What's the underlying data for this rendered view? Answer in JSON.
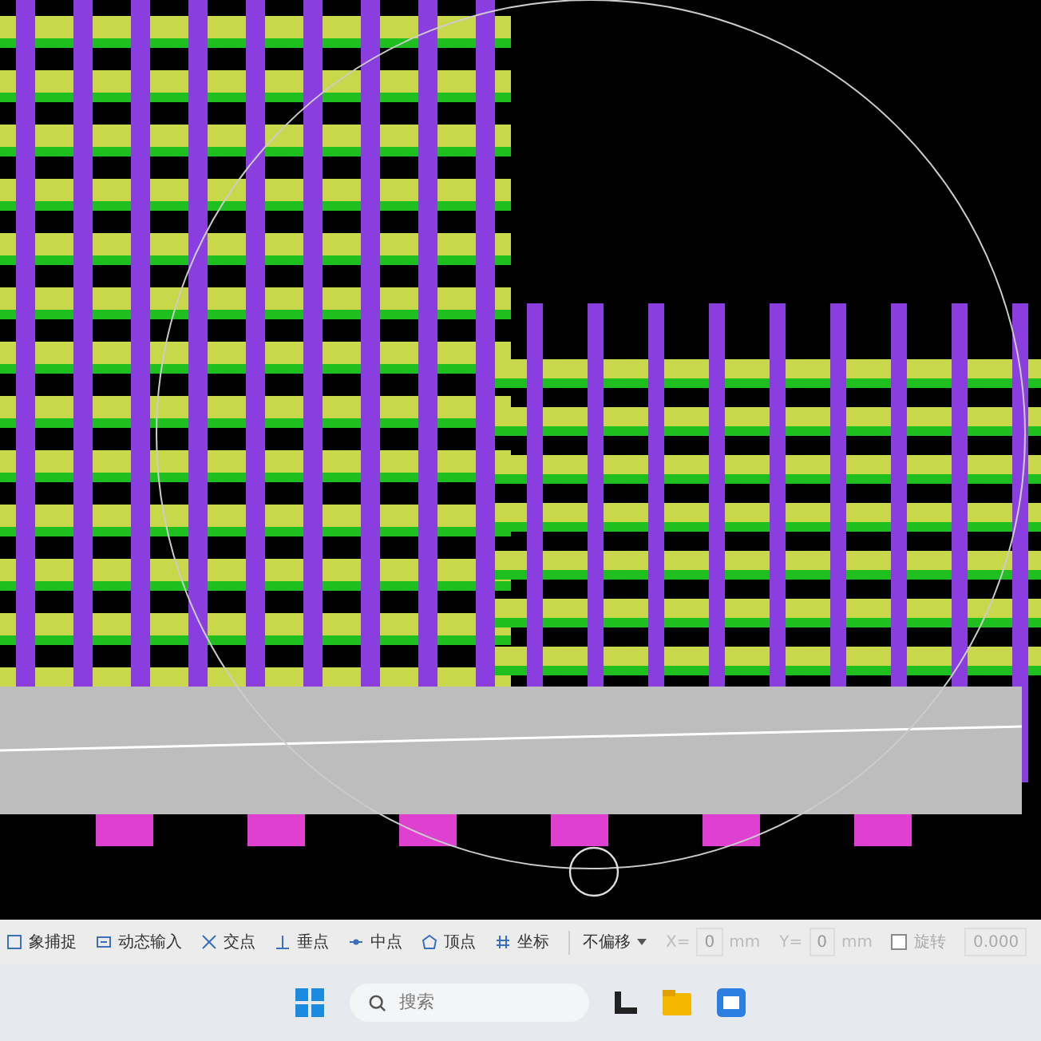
{
  "toolbar": {
    "items": [
      {
        "label": "象捕捉"
      },
      {
        "label": "动态输入"
      },
      {
        "label": "交点"
      },
      {
        "label": "垂点"
      },
      {
        "label": "中点"
      },
      {
        "label": "顶点"
      },
      {
        "label": "坐标"
      }
    ],
    "offset_dropdown": {
      "value": "不偏移"
    },
    "x_field": {
      "label": "X=",
      "value": "0",
      "unit": "mm",
      "disabled": true
    },
    "y_field": {
      "label": "Y=",
      "value": "0",
      "unit": "mm",
      "disabled": true
    },
    "rotate": {
      "label": "旋转",
      "checked": false
    },
    "angle_field": {
      "value": "0.000",
      "disabled": true
    }
  },
  "taskbar": {
    "search": {
      "placeholder": "搜索"
    }
  }
}
